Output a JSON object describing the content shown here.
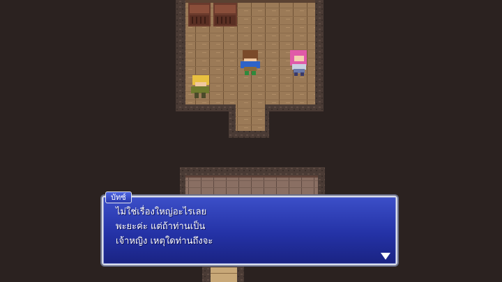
{
  "dialog": {
    "speaker": "บัทซ์",
    "lines": [
      "ไม่ใช่เรื่องใหญ่อะไรเลย",
      "พะยะค่ะ แต่ถ้าท่านเป็น",
      "เจ้าหญิง เหตุใดท่านถึงจะ"
    ],
    "advance_icon": "down-triangle-icon"
  },
  "colors": {
    "background": "#2b2220",
    "floor": "#9b7a57",
    "dialog_blue": "#2432a6",
    "dialog_border": "#d9dde8"
  }
}
